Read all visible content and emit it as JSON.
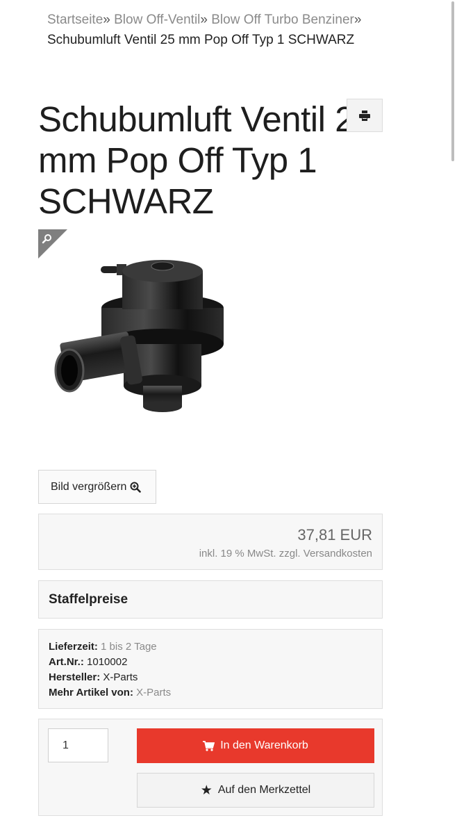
{
  "breadcrumb": {
    "items": [
      {
        "label": "Startseite"
      },
      {
        "label": "Blow Off-Ventil"
      },
      {
        "label": "Blow Off Turbo Benziner"
      }
    ],
    "separator": "»",
    "current": "Schubumluft Ventil 25 mm Pop Off Typ 1 SCHWARZ"
  },
  "product": {
    "title": "Schubumluft Ventil 25 mm Pop Off Typ 1 SCHWARZ",
    "print_icon": "print-icon",
    "zoom_icon": "magnifier-icon",
    "image_description": "black blow off valve"
  },
  "gallery": {
    "enlarge_label": "Bild vergrößern",
    "enlarge_icon": "zoom-in-icon"
  },
  "price": {
    "amount": "37,81 EUR",
    "tax_note": "inkl. 19 % MwSt. zzgl. Versandkosten"
  },
  "staffel": {
    "title": "Staffelpreise"
  },
  "details": {
    "delivery_label": "Lieferzeit:",
    "delivery_value": "1 bis 2 Tage",
    "article_label": "Art.Nr.:",
    "article_value": "1010002",
    "maker_label": "Hersteller:",
    "maker_value": "X-Parts",
    "more_label": "Mehr Artikel von:",
    "more_value": "X-Parts"
  },
  "cart": {
    "quantity": "1",
    "add_label": "In den Warenkorb",
    "add_icon": "cart-icon",
    "wish_label": "Auf den Merkzettel",
    "wish_icon": "star-icon"
  },
  "colors": {
    "accent": "#e8392c",
    "panel_bg": "#f7f7f7",
    "border": "#dedede",
    "muted_text": "#8a8a8a"
  }
}
